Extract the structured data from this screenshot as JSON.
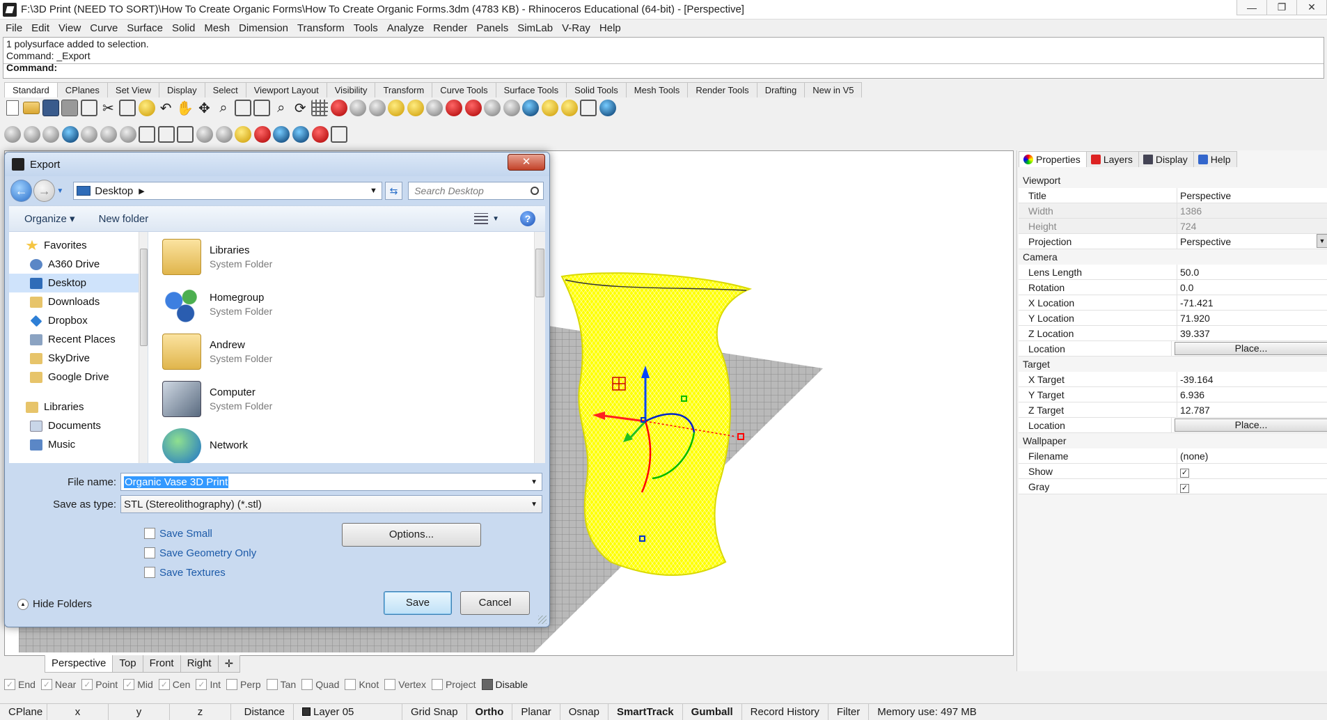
{
  "window": {
    "title": "F:\\3D Print (NEED TO SORT)\\How To Create Organic Forms\\How To Create Organic Forms.3dm (4783 KB) - Rhinoceros Educational (64-bit) - [Perspective]",
    "minimize": "—",
    "maximize": "❐",
    "close": "✕"
  },
  "menu": [
    "File",
    "Edit",
    "View",
    "Curve",
    "Surface",
    "Solid",
    "Mesh",
    "Dimension",
    "Transform",
    "Tools",
    "Analyze",
    "Render",
    "Panels",
    "SimLab",
    "V-Ray",
    "Help"
  ],
  "command": {
    "history": [
      "1 polysurface added to selection.",
      "Command: _Export"
    ],
    "prompt": "Command:"
  },
  "toolbar_tabs": [
    "Standard",
    "CPlanes",
    "Set View",
    "Display",
    "Select",
    "Viewport Layout",
    "Visibility",
    "Transform",
    "Curve Tools",
    "Surface Tools",
    "Solid Tools",
    "Mesh Tools",
    "Render Tools",
    "Drafting",
    "New in V5"
  ],
  "viewport_tabs": [
    "Perspective",
    "Top",
    "Front",
    "Right",
    "✛"
  ],
  "osnap": {
    "items": [
      {
        "label": "End",
        "checked": true
      },
      {
        "label": "Near",
        "checked": true
      },
      {
        "label": "Point",
        "checked": true
      },
      {
        "label": "Mid",
        "checked": true
      },
      {
        "label": "Cen",
        "checked": true
      },
      {
        "label": "Int",
        "checked": true
      },
      {
        "label": "Perp",
        "checked": false
      },
      {
        "label": "Tan",
        "checked": false
      },
      {
        "label": "Quad",
        "checked": false
      },
      {
        "label": "Knot",
        "checked": false
      },
      {
        "label": "Vertex",
        "checked": false
      },
      {
        "label": "Project",
        "checked": false
      }
    ],
    "disable": "Disable"
  },
  "statusbar": {
    "cplane": "CPlane",
    "x": "x",
    "y": "y",
    "z": "z",
    "distance": "Distance",
    "layer": "Layer 05",
    "grid_snap": "Grid Snap",
    "ortho": "Ortho",
    "planar": "Planar",
    "osnap": "Osnap",
    "smarttrack": "SmartTrack",
    "gumball": "Gumball",
    "record_history": "Record History",
    "filter": "Filter",
    "memory": "Memory use: 497 MB"
  },
  "panel": {
    "tabs": [
      "Properties",
      "Layers",
      "Display",
      "Help"
    ],
    "sections": {
      "viewport": "Viewport",
      "camera": "Camera",
      "target": "Target",
      "wallpaper": "Wallpaper"
    },
    "viewport": {
      "title": {
        "k": "Title",
        "v": "Perspective"
      },
      "width": {
        "k": "Width",
        "v": "1386"
      },
      "height": {
        "k": "Height",
        "v": "724"
      },
      "projection": {
        "k": "Projection",
        "v": "Perspective"
      }
    },
    "camera": {
      "lens": {
        "k": "Lens Length",
        "v": "50.0"
      },
      "rotation": {
        "k": "Rotation",
        "v": "0.0"
      },
      "xloc": {
        "k": "X Location",
        "v": "-71.421"
      },
      "yloc": {
        "k": "Y Location",
        "v": "71.920"
      },
      "zloc": {
        "k": "Z Location",
        "v": "39.337"
      },
      "location": {
        "k": "Location",
        "v": "Place..."
      }
    },
    "target": {
      "xt": {
        "k": "X Target",
        "v": "-39.164"
      },
      "yt": {
        "k": "Y Target",
        "v": "6.936"
      },
      "zt": {
        "k": "Z Target",
        "v": "12.787"
      },
      "location": {
        "k": "Location",
        "v": "Place..."
      }
    },
    "wallpaper": {
      "filename": {
        "k": "Filename",
        "v": "(none)"
      },
      "show": {
        "k": "Show",
        "checked": true
      },
      "gray": {
        "k": "Gray",
        "checked": true
      }
    }
  },
  "dialog": {
    "title": "Export",
    "close": "✕",
    "address": "Desktop",
    "search_placeholder": "Search Desktop",
    "organize": "Organize ▾",
    "new_folder": "New folder",
    "help": "?",
    "nav": {
      "favorites": "Favorites",
      "favorite_items": [
        "A360 Drive",
        "Desktop",
        "Downloads",
        "Dropbox",
        "Recent Places",
        "SkyDrive",
        "Google Drive"
      ],
      "libraries": "Libraries",
      "library_items": [
        "Documents",
        "Music"
      ]
    },
    "files": [
      {
        "name": "Libraries",
        "type": "System Folder"
      },
      {
        "name": "Homegroup",
        "type": "System Folder"
      },
      {
        "name": "Andrew",
        "type": "System Folder"
      },
      {
        "name": "Computer",
        "type": "System Folder"
      },
      {
        "name": "Network",
        "type": ""
      }
    ],
    "file_name_label": "File name:",
    "file_name": "Organic Vase 3D Print",
    "save_type_label": "Save as type:",
    "save_type": "STL (Stereolithography) (*.stl)",
    "options": [
      {
        "label": "Save Small",
        "checked": false
      },
      {
        "label": "Save Geometry Only",
        "checked": false
      },
      {
        "label": "Save Textures",
        "checked": false
      }
    ],
    "options_button": "Options...",
    "hide_folders": "Hide Folders",
    "save": "Save",
    "cancel": "Cancel"
  },
  "colors": {
    "object_highlight": "#ffff00",
    "gumball_x": "#ff0000",
    "gumball_y": "#00c000",
    "gumball_z": "#0000ff"
  }
}
